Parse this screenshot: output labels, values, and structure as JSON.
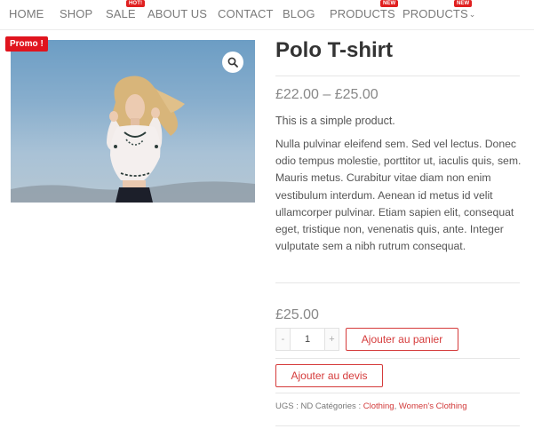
{
  "nav": {
    "items": [
      {
        "label": "HOME"
      },
      {
        "label": "SHOP"
      },
      {
        "label": "SALE",
        "badge": "HOT!"
      },
      {
        "label": "ABOUT US"
      },
      {
        "label": "CONTACT"
      },
      {
        "label": "BLOG"
      },
      {
        "label": "PRODUCTS",
        "badge": "NEW"
      },
      {
        "label": "PRODUCTS",
        "badge": "NEW"
      }
    ]
  },
  "product": {
    "promo_badge": "Promo !",
    "title": "Polo T-shirt",
    "price_range": "£22.00 – £25.00",
    "short_description": "This is a simple product.",
    "description": "Nulla pulvinar eleifend sem. Sed vel lectus. Donec odio tempus molestie, porttitor ut, iaculis quis, sem. Mauris metus. Curabitur vitae diam non enim vestibulum interdum. Aenean id metus id velit ullamcorper pulvinar. Etiam sapien elit, consequat eget, tristique non, venenatis quis, ante. Integer vulputate sem a nibh rutrum consequat.",
    "price": "£25.00",
    "quantity": "1",
    "qty_minus": "-",
    "qty_plus": "+",
    "add_to_cart": "Ajouter au panier",
    "add_to_quote": "Ajouter au devis",
    "meta": {
      "sku_text": "UGS : ND Catégories : ",
      "categories": [
        "Clothing",
        "Women's Clothing"
      ],
      "separator": ", "
    }
  },
  "colors": {
    "accent": "#d53b3b",
    "promo": "#e0141e",
    "nav_text": "#7a7a7a"
  }
}
